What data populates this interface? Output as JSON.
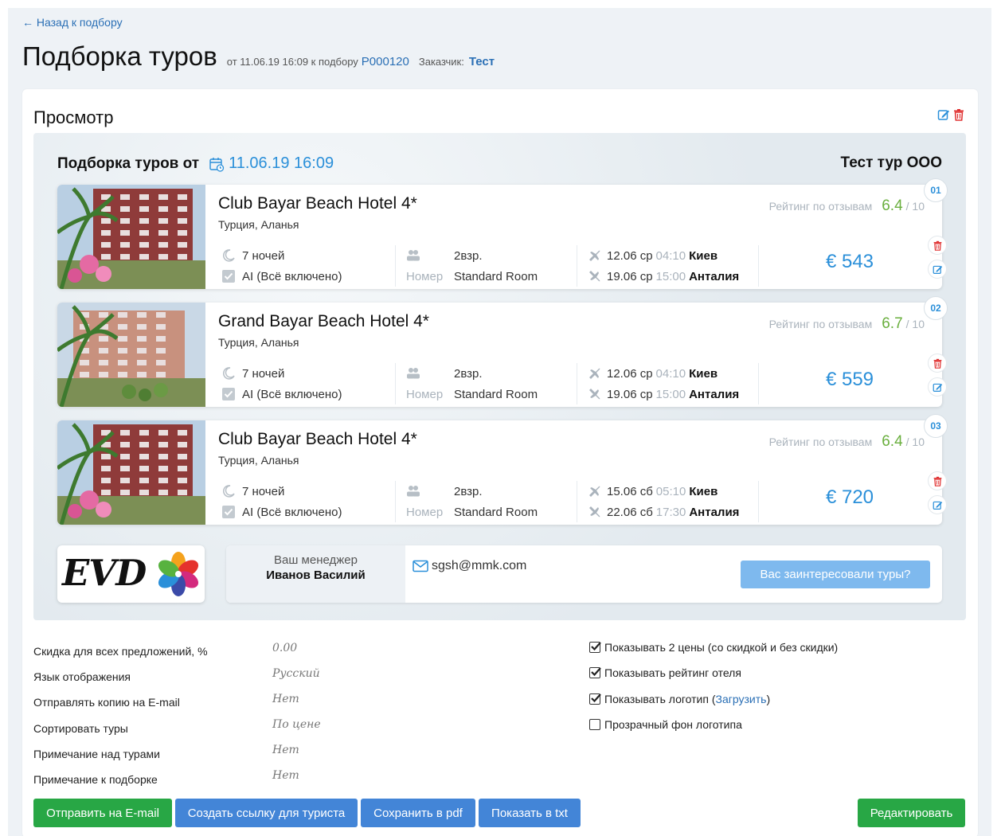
{
  "nav": {
    "back": "← Назад к подбору"
  },
  "header": {
    "title": "Подборка туров",
    "meta_prefix": "от 11.06.19 16:09 к подбору",
    "selection_id": "P000120",
    "client_label": "Заказчик:",
    "client_name": "Тест"
  },
  "panel": {
    "title": "Просмотр"
  },
  "preview": {
    "heading": "Подборка туров от",
    "date": "11.06.19 16:09",
    "company": "Тест тур ООО"
  },
  "colors": {
    "accent": "#2a8fd9",
    "rating": "#6aaf3e",
    "button_green": "#28a745",
    "button_blue": "#4385d7"
  },
  "tours": [
    {
      "num": "01",
      "hotel": "Club Bayar Beach Hotel 4*",
      "location": "Турция, Аланья",
      "rating_label": "Рейтинг по отзывам",
      "rating": "6.4",
      "rating_max": "/ 10",
      "nights": "7 ночей",
      "board": "AI (Всё включено)",
      "guests": "2взр.",
      "room_label": "Номер",
      "room": "Standard Room",
      "out_date": "12.06 ср",
      "out_time": "04:10",
      "out_city": "Киев",
      "back_date": "19.06 ср",
      "back_time": "15:00",
      "back_city": "Анталия",
      "price": "€ 543"
    },
    {
      "num": "02",
      "hotel": "Grand Bayar Beach Hotel 4*",
      "location": "Турция, Аланья",
      "rating_label": "Рейтинг по отзывам",
      "rating": "6.7",
      "rating_max": "/ 10",
      "nights": "7 ночей",
      "board": "AI (Всё включено)",
      "guests": "2взр.",
      "room_label": "Номер",
      "room": "Standard Room",
      "out_date": "12.06 ср",
      "out_time": "04:10",
      "out_city": "Киев",
      "back_date": "19.06 ср",
      "back_time": "15:00",
      "back_city": "Анталия",
      "price": "€ 559"
    },
    {
      "num": "03",
      "hotel": "Club Bayar Beach Hotel 4*",
      "location": "Турция, Аланья",
      "rating_label": "Рейтинг по отзывам",
      "rating": "6.4",
      "rating_max": "/ 10",
      "nights": "7 ночей",
      "board": "AI (Всё включено)",
      "guests": "2взр.",
      "room_label": "Номер",
      "room": "Standard Room",
      "out_date": "15.06 сб",
      "out_time": "05:10",
      "out_city": "Киев",
      "back_date": "22.06 сб",
      "back_time": "17:30",
      "back_city": "Анталия",
      "price": "€ 720"
    }
  ],
  "logo": {
    "text": "EVD"
  },
  "manager": {
    "caption": "Ваш менеджер",
    "name": "Иванов Василий",
    "email": "sgsh@mmk.com",
    "cta": "Вас заинтересовали туры?"
  },
  "settings": [
    {
      "label": "Скидка для всех предложений, %",
      "value": "0.00"
    },
    {
      "label": "Язык отображения",
      "value": "Русский"
    },
    {
      "label": "Отправлять копию на E-mail",
      "value": "Нет"
    },
    {
      "label": "Сортировать туры",
      "value": "По цене"
    },
    {
      "label": "Примечание над турами",
      "value": "Нет"
    },
    {
      "label": "Примечание к подборке",
      "value": "Нет"
    }
  ],
  "options": [
    {
      "label": "Показывать 2 цены (со скидкой и без скидки)",
      "checked": true
    },
    {
      "label": "Показывать рейтинг отеля",
      "checked": true
    },
    {
      "label": "Показывать логотип (",
      "link": "Загрузить",
      "suffix": ")",
      "checked": true
    },
    {
      "label": "Прозрачный фон логотипа",
      "checked": false
    }
  ],
  "actions": {
    "send_email": "Отправить на E-mail",
    "create_link": "Создать ссылку для туриста",
    "save_pdf": "Сохранить в pdf",
    "show_txt": "Показать в txt",
    "edit": "Редактировать"
  }
}
